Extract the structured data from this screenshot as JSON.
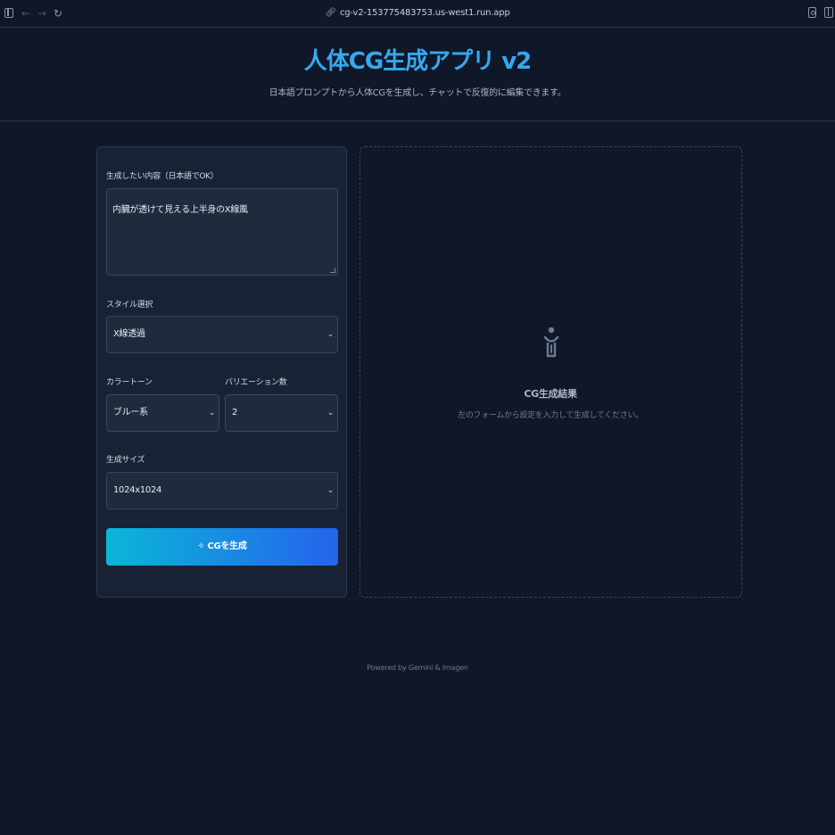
{
  "browser": {
    "url": "cg-v2-153775483753.us-west1.run.app",
    "back_glyph": "←",
    "forward_glyph": "→",
    "reload_glyph": "↻"
  },
  "header": {
    "title": "人体CG生成アプリ v2",
    "subtitle": "日本語プロンプトから人体CGを生成し、チャットで反復的に編集できます。"
  },
  "form": {
    "prompt_label": "生成したい内容（日本語でOK）",
    "prompt_value": "内臓が透けて見える上半身のX線風",
    "style_label": "スタイル選択",
    "style_value": "X線透過",
    "color_tone_label": "カラートーン",
    "color_tone_value": "ブルー系",
    "variation_label": "バリエーション数",
    "variation_value": "2",
    "size_label": "生成サイズ",
    "size_value": "1024x1024",
    "generate_button_label": "CGを生成",
    "chevron_glyph": "⌄",
    "spark_glyph": "✧"
  },
  "result": {
    "title": "CG生成結果",
    "description": "左のフォームから設定を入力して生成してください。"
  },
  "footer": {
    "text": "Powered by Gemini & Imagen"
  },
  "colors": {
    "background": "#0f1729",
    "panel": "#182234",
    "accent_title": "#34a9f0",
    "button_gradient_start": "#0bb6d8",
    "button_gradient_end": "#2563eb"
  },
  "icons": {
    "browser": [
      "sidebar-icon",
      "back-arrow-icon",
      "forward-arrow-icon",
      "reload-icon",
      "link-icon",
      "extension-icon",
      "split-view-icon"
    ],
    "result_placeholder": "person-icon",
    "generate_button": "sparkle-icon"
  }
}
